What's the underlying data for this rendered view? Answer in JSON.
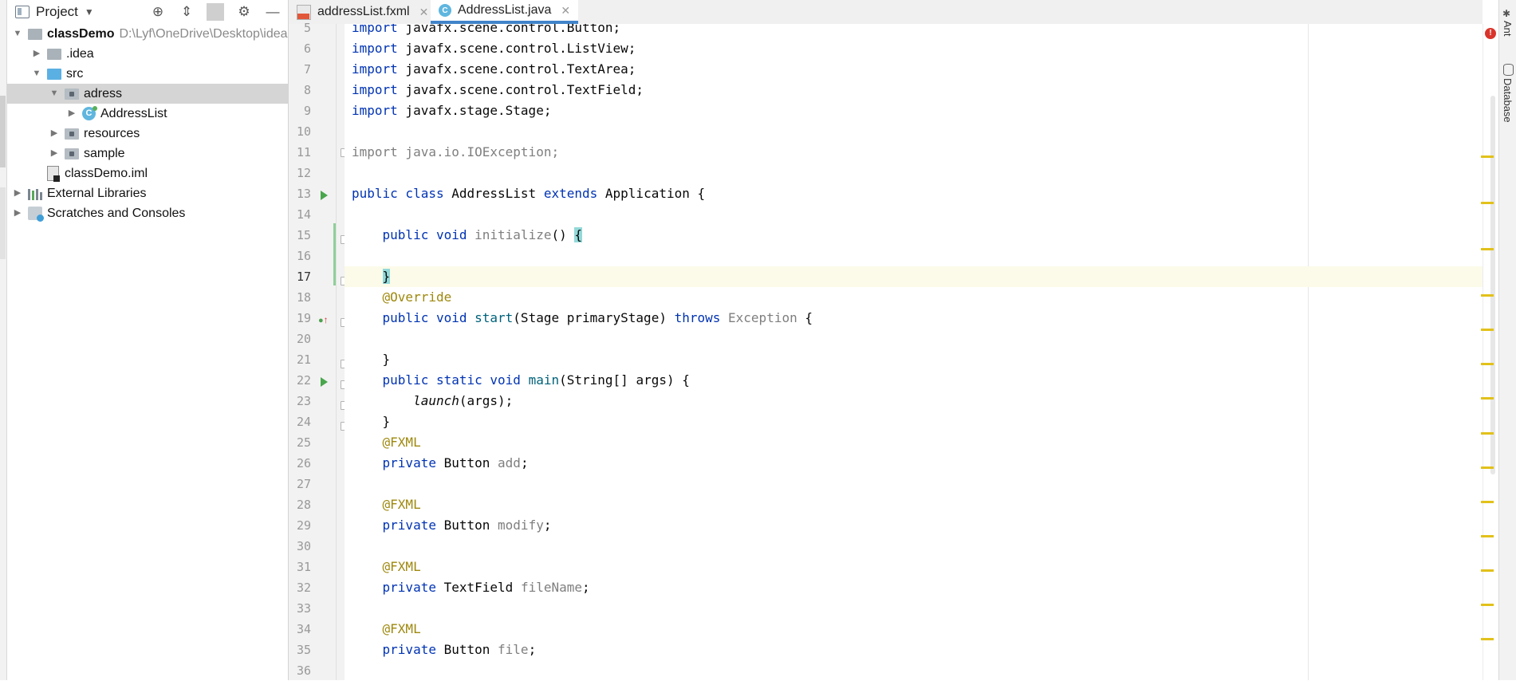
{
  "project_panel": {
    "title": "Project",
    "tree": [
      {
        "label": "classDemo",
        "path": "D:\\Lyf\\OneDrive\\Desktop\\idea"
      },
      {
        "label": ".idea"
      },
      {
        "label": "src"
      },
      {
        "label": "adress"
      },
      {
        "label": "AddressList"
      },
      {
        "label": "resources"
      },
      {
        "label": "sample"
      },
      {
        "label": "classDemo.iml"
      },
      {
        "label": "External Libraries"
      },
      {
        "label": "Scratches and Consoles"
      }
    ]
  },
  "tabs": [
    {
      "label": "addressList.fxml",
      "active": false
    },
    {
      "label": "AddressList.java",
      "active": true
    }
  ],
  "editor": {
    "current_line": 17,
    "line_numbers": [
      "5",
      "6",
      "7",
      "8",
      "9",
      "10",
      "11",
      "12",
      "13",
      "14",
      "15",
      "16",
      "17",
      "18",
      "19",
      "20",
      "21",
      "22",
      "23",
      "24",
      "25",
      "26",
      "27",
      "28",
      "29",
      "30",
      "31",
      "32",
      "33",
      "34",
      "35",
      "36"
    ],
    "lines": {
      "l5": {
        "a": "import",
        "b": " javafx.scene.control.Button;"
      },
      "l6": {
        "a": "import",
        "b": " javafx.scene.control.ListView;"
      },
      "l7": {
        "a": "import",
        "b": " javafx.scene.control.TextArea;"
      },
      "l8": {
        "a": "import",
        "b": " javafx.scene.control.TextField;"
      },
      "l9": {
        "a": "import",
        "b": " javafx.stage.Stage;"
      },
      "l11": {
        "text": "import java.io.IOException;"
      },
      "l13": {
        "k1": "public",
        "k2": " class",
        "t1": " AddressList ",
        "k3": "extends",
        "t2": " Application {"
      },
      "l15": {
        "ind": "    ",
        "k1": "public",
        "k2": " void",
        "f": " initialize",
        "t": "() ",
        "brace": "{"
      },
      "l17": {
        "ind": "    ",
        "brace": "}"
      },
      "l18": {
        "ind": "    ",
        "ann": "@Override"
      },
      "l19": {
        "ind": "    ",
        "k1": "public",
        "k2": " void",
        "f": " start",
        "t1": "(Stage primaryStage) ",
        "k3": "throws",
        "g": " Exception",
        "t2": " {"
      },
      "l21": {
        "ind": "    ",
        "t": "}"
      },
      "l22": {
        "ind": "    ",
        "k1": "public",
        "k2": " static",
        "k3": " void",
        "f": " main",
        "t": "(String[] args) {"
      },
      "l23": {
        "ind": "        ",
        "it": "launch",
        "t": "(args);"
      },
      "l24": {
        "ind": "    ",
        "t": "}"
      },
      "l25": {
        "ind": "    ",
        "ann": "@FXML"
      },
      "l26": {
        "ind": "    ",
        "k": "private",
        "t": " Button ",
        "g": "add",
        "e": ";"
      },
      "l28": {
        "ind": "    ",
        "ann": "@FXML"
      },
      "l29": {
        "ind": "    ",
        "k": "private",
        "t": " Button ",
        "g": "modify",
        "e": ";"
      },
      "l31": {
        "ind": "    ",
        "ann": "@FXML"
      },
      "l32": {
        "ind": "    ",
        "k": "private",
        "t": " TextField ",
        "g": "fileName",
        "e": ";"
      },
      "l34": {
        "ind": "    ",
        "ann": "@FXML"
      },
      "l35": {
        "ind": "    ",
        "k": "private",
        "t": " Button ",
        "g": "file",
        "e": ";"
      }
    }
  },
  "right_tools": {
    "ant": "Ant",
    "database": "Database"
  },
  "error_badge": "!",
  "colors": {
    "keyword": "#0033b3",
    "annotation": "#9e880d",
    "unused": "#7f7f7f",
    "method": "#00627a",
    "tab_accent": "#4083c9",
    "current_line": "#fcfae9"
  }
}
